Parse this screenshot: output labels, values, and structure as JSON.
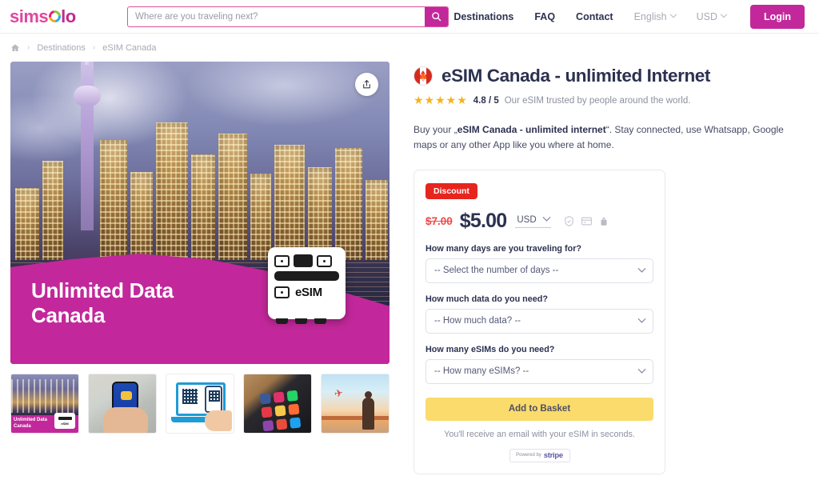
{
  "header": {
    "logo": {
      "part1": "sims",
      "ring_icon": "colored-ring-o",
      "part2": "l",
      "part3": "o"
    },
    "search": {
      "placeholder": "Where are you traveling next?",
      "value": "",
      "icon": "search-icon"
    },
    "nav": [
      {
        "label": "Destinations",
        "muted": false
      },
      {
        "label": "FAQ",
        "muted": false
      },
      {
        "label": "Contact",
        "muted": false
      },
      {
        "label": "English",
        "muted": true,
        "icon": "chevron-down-icon"
      },
      {
        "label": "USD",
        "muted": true,
        "icon": "chevron-down-icon"
      }
    ],
    "login_label": "Login"
  },
  "breadcrumb": {
    "home_icon": "home-icon",
    "separator": "›",
    "items": [
      {
        "label": "Destinations"
      },
      {
        "label": "eSIM Canada"
      }
    ]
  },
  "hero": {
    "banner_title_line1": "Unlimited Data",
    "banner_title_line2": "Canada",
    "share_icon": "share-upload-icon",
    "esim_label": "eSIM",
    "accent_color": "#c2289b"
  },
  "thumbnails": [
    {
      "name": "thumbnail-hero-toronto-banner",
      "caption_line1": "Unlimited Data",
      "caption_line2": "Canada",
      "chip_label": "eSIM"
    },
    {
      "name": "thumbnail-hand-holding-phone"
    },
    {
      "name": "thumbnail-laptop-qr-scan"
    },
    {
      "name": "thumbnail-phone-apps"
    },
    {
      "name": "thumbnail-traveler-airport"
    }
  ],
  "product": {
    "flag_icon": "canada-flag-icon",
    "title": "eSIM Canada - unlimited Internet",
    "stars": "★★★★★",
    "rating_value": "4.8 / 5",
    "rating_text": "Our eSIM trusted by people around the world.",
    "description_pre": "Buy your „eSIM Canada - unlimited internet“. ",
    "description_bold": "eSIM Canada - unlimited internet",
    "description_part1": "Buy your „",
    "description_part2": "“. Stay connected, use Whatsapp, Google maps or any other App like you where at home."
  },
  "purchase": {
    "discount_badge": "Discount",
    "old_price": "$7.00",
    "new_price": "$5.00",
    "currency": "USD",
    "currency_icon": "chevron-down-icon",
    "trust_icons": [
      "shield-check-icon",
      "credit-card-icon",
      "lock-tag-icon"
    ],
    "fields": [
      {
        "label": "How many days are you traveling for?",
        "value": "-- Select the number of days --",
        "name": "days-select"
      },
      {
        "label": "How much data do you need?",
        "value": "-- How much data? --",
        "name": "data-select"
      },
      {
        "label": "How many eSIMs do you need?",
        "value": "-- How many eSIMs? --",
        "name": "esim-count-select"
      }
    ],
    "cta_label": "Add to Basket",
    "note": "You'll receive an email with your eSIM in seconds.",
    "stripe_powered": "Powered by",
    "stripe_name": "stripe"
  }
}
